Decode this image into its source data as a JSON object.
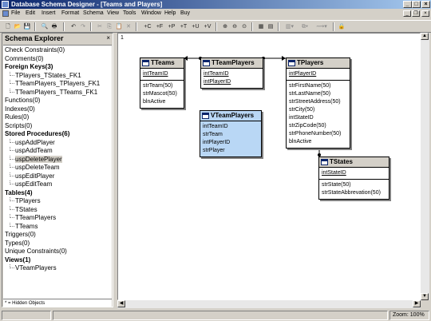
{
  "window": {
    "title": "Database Schema Designer - [Teams and Players]"
  },
  "menu": [
    "File",
    "Edit",
    "Insert",
    "Format",
    "Schema",
    "View",
    "Tools",
    "Window",
    "Help",
    "Buy"
  ],
  "toolbar": {
    "icons": [
      "new-icon",
      "open-icon",
      "save-icon",
      "print-preview-icon",
      "print-icon",
      "undo-icon",
      "redo-icon",
      "cut-icon",
      "copy-icon",
      "paste-icon",
      "delete-icon",
      "add-constraint-icon",
      "add-foreign-key-icon",
      "add-procedure-icon",
      "add-table-icon",
      "add-unique-icon",
      "add-view-icon",
      "zoom-in-icon",
      "zoom-out-icon",
      "zoom-fit-icon",
      "layout-icon",
      "align-icon",
      "grid-icon",
      "arrange-icon",
      "link-style-icon",
      "lock-icon"
    ],
    "labels": [
      "+C",
      "+F",
      "+P",
      "+T",
      "+U",
      "+V"
    ]
  },
  "explorer": {
    "title": "Schema Explorer",
    "close": "×",
    "footer": "* = Hidden Objects",
    "tree": [
      {
        "label": "Check Constraints(0)",
        "level": 0,
        "bold": false
      },
      {
        "label": "Comments(0)",
        "level": 0,
        "bold": false
      },
      {
        "label": "Foreign Keys(3)",
        "level": 0,
        "bold": true
      },
      {
        "label": "TPlayers_TStates_FK1",
        "level": 1,
        "bold": false
      },
      {
        "label": "TTeamPlayers_TPlayers_FK1",
        "level": 1,
        "bold": false
      },
      {
        "label": "TTeamPlayers_TTeams_FK1",
        "level": 1,
        "bold": false
      },
      {
        "label": "Functions(0)",
        "level": 0,
        "bold": false
      },
      {
        "label": "Indexes(0)",
        "level": 0,
        "bold": false
      },
      {
        "label": "Rules(0)",
        "level": 0,
        "bold": false
      },
      {
        "label": "Scripts(0)",
        "level": 0,
        "bold": false
      },
      {
        "label": "Stored Procedures(6)",
        "level": 0,
        "bold": true
      },
      {
        "label": "uspAddPlayer",
        "level": 1,
        "bold": false
      },
      {
        "label": "uspAddTeam",
        "level": 1,
        "bold": false
      },
      {
        "label": "uspDeletePlayer",
        "level": 1,
        "bold": false,
        "selected": true
      },
      {
        "label": "uspDeleteTeam",
        "level": 1,
        "bold": false
      },
      {
        "label": "uspEditPlayer",
        "level": 1,
        "bold": false
      },
      {
        "label": "uspEditTeam",
        "level": 1,
        "bold": false
      },
      {
        "label": "Tables(4)",
        "level": 0,
        "bold": true
      },
      {
        "label": "TPlayers",
        "level": 1,
        "bold": false
      },
      {
        "label": "TStates",
        "level": 1,
        "bold": false
      },
      {
        "label": "TTeamPlayers",
        "level": 1,
        "bold": false
      },
      {
        "label": "TTeams",
        "level": 1,
        "bold": false
      },
      {
        "label": "Triggers(0)",
        "level": 0,
        "bold": false
      },
      {
        "label": "Types(0)",
        "level": 0,
        "bold": false
      },
      {
        "label": "Unique Constraints(0)",
        "level": 0,
        "bold": false
      },
      {
        "label": "Views(1)",
        "level": 0,
        "bold": true
      },
      {
        "label": "VTeamPlayers",
        "level": 1,
        "bold": false
      }
    ]
  },
  "diagram": {
    "page_number": "1",
    "tables": {
      "tteams": {
        "name": "TTeams",
        "keys": [
          "intTeamID"
        ],
        "fields": [
          "strTeam(50)",
          "strMascot(50)",
          "blnActive"
        ]
      },
      "tteamplayers": {
        "name": "TTeamPlayers",
        "keys": [
          "intTeamID",
          "intPlayerID"
        ],
        "fields": []
      },
      "tplayers": {
        "name": "TPlayers",
        "keys": [
          "intPlayerID"
        ],
        "fields": [
          "strFirstName(50)",
          "strLastName(50)",
          "strStreetAddress(50)",
          "strCity(50)",
          "intStateID",
          "strZipCode(50)",
          "strPhoneNumber(50)",
          "blnActive"
        ]
      },
      "tstates": {
        "name": "TStates",
        "keys": [
          "intStateID"
        ],
        "fields": [
          "strState(50)",
          "strStateAbbrevation(50)"
        ]
      }
    },
    "view": {
      "name": "VTeamPlayers",
      "fields": [
        "intTeamID",
        "strTeam",
        "intPlayerID",
        "strPlayer"
      ]
    }
  },
  "status": {
    "zoom": "Zoom: 100%"
  }
}
